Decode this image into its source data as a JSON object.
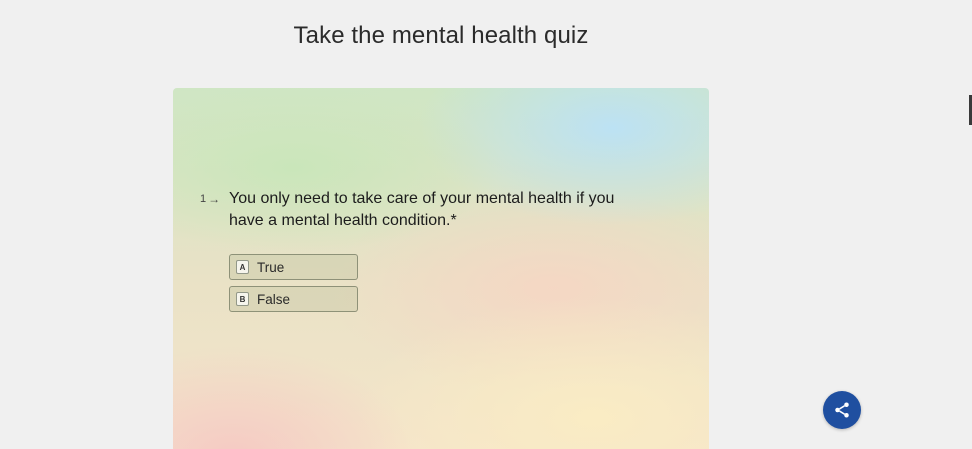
{
  "page": {
    "title": "Take the mental health quiz"
  },
  "question": {
    "number": "1",
    "arrow_icon": "arrow-right-icon",
    "text": "You only need to take care of your mental health if you have a mental health condition.*"
  },
  "choices": [
    {
      "key": "A",
      "label": "True"
    },
    {
      "key": "B",
      "label": "False"
    }
  ],
  "share": {
    "icon": "share-icon",
    "color": "#1f4fa0"
  }
}
